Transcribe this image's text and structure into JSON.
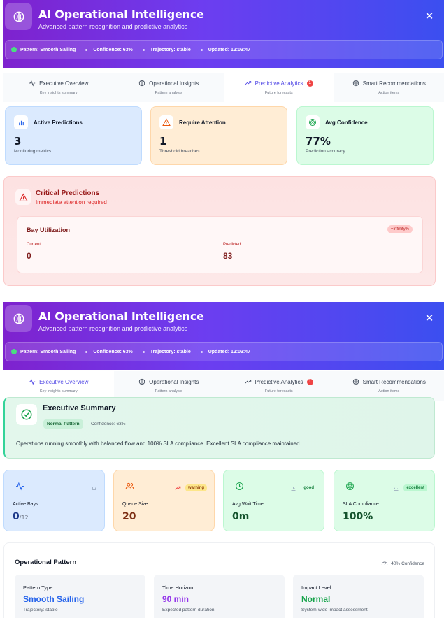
{
  "header": {
    "title": "AI Operational Intelligence",
    "subtitle": "Advanced pattern recognition and predictive analytics",
    "close_icon": "close-icon",
    "logo_icon": "brain-icon"
  },
  "status": {
    "pattern": "Pattern: Smooth Sailing",
    "confidence": "Confidence: 63%",
    "trajectory": "Trajectory: stable",
    "updated": "Updated: 12:03:47"
  },
  "tabs": [
    {
      "label": "Executive Overview",
      "desc": "Key insights summary",
      "icon": "activity-icon"
    },
    {
      "label": "Operational Insights",
      "desc": "Pattern analysis",
      "icon": "brain-icon"
    },
    {
      "label": "Predictive Analytics",
      "desc": "Future forecasts",
      "icon": "trending-up-icon",
      "badge": "1"
    },
    {
      "label": "Smart Recommendations",
      "desc": "Action items",
      "icon": "target-icon"
    }
  ],
  "predictive": {
    "stats": [
      {
        "title": "Active Predictions",
        "value": "3",
        "sub": "Monitoring metrics",
        "icon": "bar-chart-icon",
        "color": "#dbeafe"
      },
      {
        "title": "Require Attention",
        "value": "1",
        "sub": "Threshold breaches",
        "icon": "alert-triangle-icon",
        "color": "#ffedd5"
      },
      {
        "title": "Avg Confidence",
        "value": "77%",
        "sub": "Prediction accuracy",
        "icon": "target-icon",
        "color": "#dcfce7"
      }
    ],
    "critical": {
      "title": "Critical Predictions",
      "subtitle": "Immediate attention required",
      "item": {
        "name": "Bay Utilization",
        "change": "+Infinity%",
        "current_label": "Current",
        "current_value": "0",
        "predicted_label": "Predicted",
        "predicted_value": "83"
      }
    }
  },
  "overview": {
    "summary": {
      "title": "Executive Summary",
      "chip": "Normal Pattern",
      "confidence": "Confidence: 63%",
      "text": "Operations running smoothly with balanced flow and 100% SLA compliance. Excellent SLA compliance maintained."
    },
    "kpis": [
      {
        "label": "Active Bays",
        "value": "0",
        "unit": "/12",
        "status": "",
        "icon": "activity-icon"
      },
      {
        "label": "Queue Size",
        "value": "20",
        "unit": "",
        "status": "warning",
        "icon": "users-icon"
      },
      {
        "label": "Avg Wait Time",
        "value": "0m",
        "unit": "",
        "status": "good",
        "icon": "clock-icon"
      },
      {
        "label": "SLA Compliance",
        "value": "100%",
        "unit": "",
        "status": "excellent",
        "icon": "target-icon"
      }
    ],
    "pattern": {
      "title": "Operational Pattern",
      "confidence": "40% Confidence",
      "tiles": [
        {
          "label": "Pattern Type",
          "value": "Smooth Sailing",
          "sub": "Trajectory: stable",
          "color": "#2563eb"
        },
        {
          "label": "Time Horizon",
          "value": "90 min",
          "sub": "Expected pattern duration",
          "color": "#9333ea"
        },
        {
          "label": "Impact Level",
          "value": "Normal",
          "sub": "System-wide impact assessment",
          "color": "#16a34a"
        }
      ]
    }
  }
}
